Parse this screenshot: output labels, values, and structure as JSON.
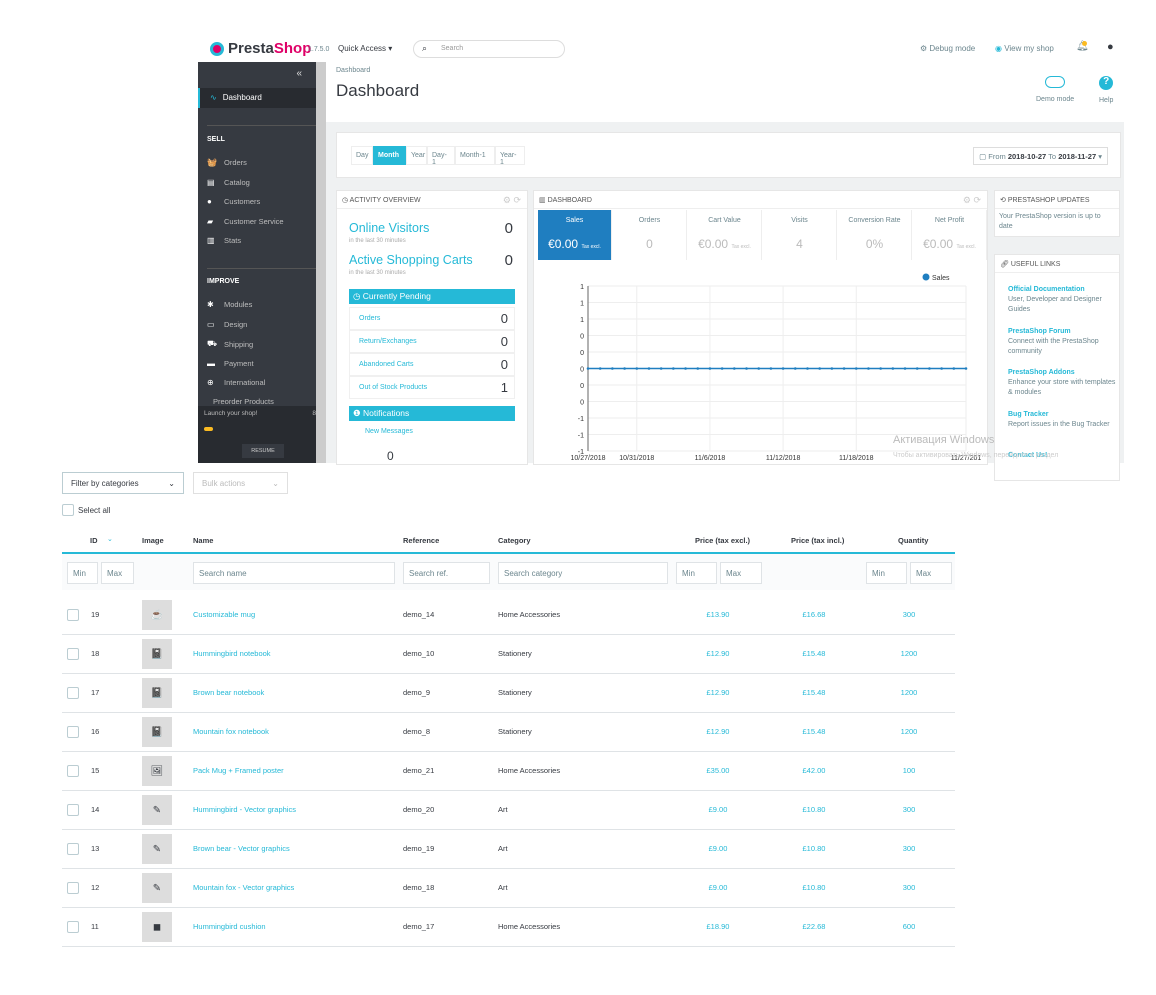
{
  "header": {
    "brand_a": "Presta",
    "brand_b": "Shop",
    "version": "1.7.5.0",
    "quick_access": "Quick Access ▾",
    "search_placeholder": "Search",
    "debug_mode": "Debug mode",
    "view_shop": "View my shop"
  },
  "sidebar": {
    "collapse": "«",
    "active": "Dashboard",
    "sell_title": "SELL",
    "sell_items": [
      {
        "icon": "basket-icon",
        "glyph": "🧺",
        "label": "Orders"
      },
      {
        "icon": "store-icon",
        "glyph": "▤",
        "label": "Catalog"
      },
      {
        "icon": "user-icon",
        "glyph": "●",
        "label": "Customers"
      },
      {
        "icon": "chat-icon",
        "glyph": "▰",
        "label": "Customer Service"
      },
      {
        "icon": "stats-icon",
        "glyph": "▥",
        "label": "Stats"
      }
    ],
    "improve_title": "IMPROVE",
    "improve_items": [
      {
        "icon": "puzzle-icon",
        "glyph": "✱",
        "label": "Modules"
      },
      {
        "icon": "monitor-icon",
        "glyph": "▭",
        "label": "Design"
      },
      {
        "icon": "truck-icon",
        "glyph": "⛟",
        "label": "Shipping"
      },
      {
        "icon": "card-icon",
        "glyph": "▬",
        "label": "Payment"
      },
      {
        "icon": "globe-icon",
        "glyph": "⊕",
        "label": "International"
      }
    ],
    "extra_item": "Preorder Products",
    "launch": "Launch your shop!",
    "launch_pct": "8",
    "launch_progress": 0.08,
    "resume": "RESUME"
  },
  "page": {
    "breadcrumb": "Dashboard",
    "title": "Dashboard",
    "demo_mode": "Demo mode",
    "help": "Help"
  },
  "periods": [
    {
      "label": "Day",
      "active": false
    },
    {
      "label": "Month",
      "active": true
    },
    {
      "label": "Year",
      "active": false
    },
    {
      "label": "Day-1",
      "active": false
    },
    {
      "label": "Month-1",
      "active": false
    },
    {
      "label": "Year-1",
      "active": false
    }
  ],
  "date_range": {
    "from_label": "From",
    "from": "2018-10-27",
    "to_label": "To",
    "to": "2018-11-27"
  },
  "activity": {
    "title": "ACTIVITY OVERVIEW",
    "visitors_label": "Online Visitors",
    "visitors": "0",
    "visitors_sub": "in the last 30 minutes",
    "carts_label": "Active Shopping Carts",
    "carts": "0",
    "carts_sub": "in the last 30 minutes",
    "pending_title": "Currently Pending",
    "pending": [
      {
        "label": "Orders",
        "value": "0"
      },
      {
        "label": "Return/Exchanges",
        "value": "0"
      },
      {
        "label": "Abandoned Carts",
        "value": "0"
      },
      {
        "label": "Out of Stock Products",
        "value": "1"
      }
    ],
    "notifications_title": "Notifications",
    "new_messages": "New Messages",
    "new_messages_count": "0"
  },
  "dashboard": {
    "title": "DASHBOARD",
    "kpis": [
      {
        "label": "Sales",
        "value": "€0.00",
        "suffix": "Tax excl."
      },
      {
        "label": "Orders",
        "value": "0",
        "suffix": ""
      },
      {
        "label": "Cart Value",
        "value": "€0.00",
        "suffix": "Tax excl."
      },
      {
        "label": "Visits",
        "value": "4",
        "suffix": ""
      },
      {
        "label": "Conversion Rate",
        "value": "0%",
        "suffix": ""
      },
      {
        "label": "Net Profit",
        "value": "€0.00",
        "suffix": "Tax excl."
      }
    ]
  },
  "chart_data": {
    "type": "line",
    "legend": "top-right",
    "grid": true,
    "series": [
      {
        "name": "Sales",
        "color": "#1f7ec0",
        "values": [
          0,
          0,
          0,
          0,
          0,
          0,
          0,
          0,
          0,
          0,
          0,
          0,
          0,
          0,
          0,
          0,
          0,
          0,
          0,
          0,
          0,
          0,
          0,
          0,
          0,
          0,
          0,
          0,
          0,
          0,
          0,
          0
        ]
      }
    ],
    "x_start": "10/27/2018",
    "x_end": "11/27/2018",
    "x_tick_labels": [
      "10/27/2018",
      "10/31/2018",
      "11/6/2018",
      "11/12/2018",
      "11/18/2018",
      "11/27/201"
    ],
    "x_tick_days": [
      0,
      4,
      10,
      16,
      22,
      31
    ],
    "ylim": [
      -1,
      1
    ],
    "y_tick_labels": [
      "1",
      "1",
      "1",
      "0",
      "0",
      "0",
      "0",
      "0",
      "-1",
      "-1",
      "-1"
    ]
  },
  "updates": {
    "title": "PRESTASHOP UPDATES",
    "text": "Your PrestaShop version is up to date"
  },
  "useful_links": {
    "title": "USEFUL LINKS",
    "items": [
      {
        "title": "Official Documentation",
        "desc": "User, Developer and Designer Guides"
      },
      {
        "title": "PrestaShop Forum",
        "desc": "Connect with the PrestaShop community"
      },
      {
        "title": "PrestaShop Addons",
        "desc": "Enhance your store with templates & modules"
      },
      {
        "title": "Bug Tracker",
        "desc": "Report issues in the Bug Tracker"
      },
      {
        "title": "Contact Us!",
        "desc": ""
      }
    ]
  },
  "watermark": {
    "line1": "Активация Windows",
    "line2": "Чтобы активировать Windows, перейдите в раздел"
  },
  "products": {
    "filter_categories": "Filter by categories",
    "bulk_actions": "Bulk actions",
    "select_all": "Select all",
    "columns": [
      "ID",
      "Image",
      "Name",
      "Reference",
      "Category",
      "Price (tax excl.)",
      "Price (tax incl.)",
      "Quantity"
    ],
    "filters": {
      "min": "Min",
      "max": "Max",
      "name": "Search name",
      "ref": "Search ref.",
      "category": "Search category"
    },
    "rows": [
      {
        "id": "19",
        "name": "Customizable mug",
        "ref": "demo_14",
        "category": "Home Accessories",
        "excl": "£13.90",
        "incl": "£16.68",
        "qty": "300"
      },
      {
        "id": "18",
        "name": "Hummingbird notebook",
        "ref": "demo_10",
        "category": "Stationery",
        "excl": "£12.90",
        "incl": "£15.48",
        "qty": "1200"
      },
      {
        "id": "17",
        "name": "Brown bear notebook",
        "ref": "demo_9",
        "category": "Stationery",
        "excl": "£12.90",
        "incl": "£15.48",
        "qty": "1200"
      },
      {
        "id": "16",
        "name": "Mountain fox notebook",
        "ref": "demo_8",
        "category": "Stationery",
        "excl": "£12.90",
        "incl": "£15.48",
        "qty": "1200"
      },
      {
        "id": "15",
        "name": "Pack Mug + Framed poster",
        "ref": "demo_21",
        "category": "Home Accessories",
        "excl": "£35.00",
        "incl": "£42.00",
        "qty": "100"
      },
      {
        "id": "14",
        "name": "Hummingbird - Vector graphics",
        "ref": "demo_20",
        "category": "Art",
        "excl": "£9.00",
        "incl": "£10.80",
        "qty": "300"
      },
      {
        "id": "13",
        "name": "Brown bear - Vector graphics",
        "ref": "demo_19",
        "category": "Art",
        "excl": "£9.00",
        "incl": "£10.80",
        "qty": "300"
      },
      {
        "id": "12",
        "name": "Mountain fox - Vector graphics",
        "ref": "demo_18",
        "category": "Art",
        "excl": "£9.00",
        "incl": "£10.80",
        "qty": "300"
      },
      {
        "id": "11",
        "name": "Hummingbird cushion",
        "ref": "demo_17",
        "category": "Home Accessories",
        "excl": "£18.90",
        "incl": "£22.68",
        "qty": "600"
      }
    ]
  }
}
